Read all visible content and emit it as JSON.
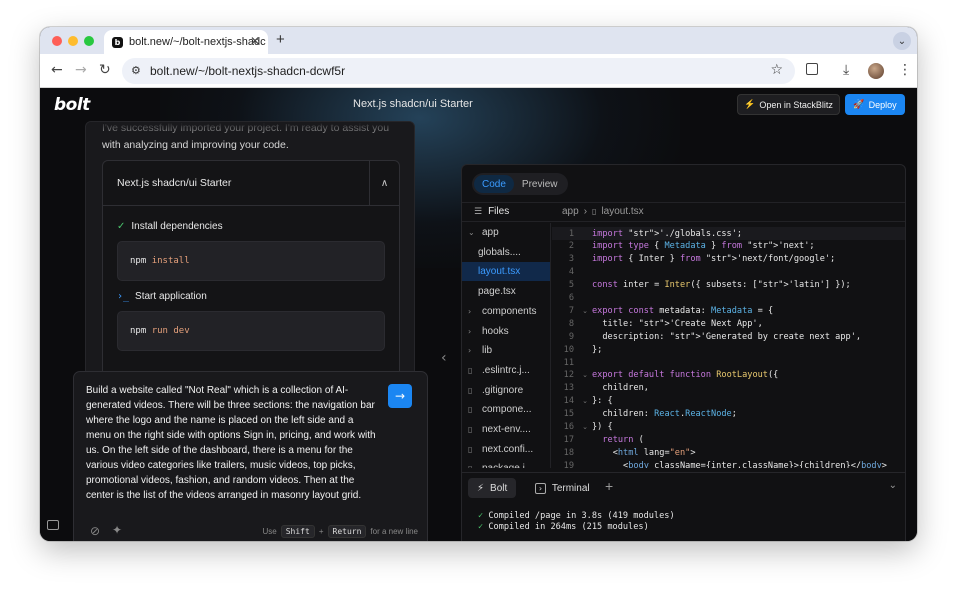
{
  "browser": {
    "tab_title": "bolt.new/~/bolt-nextjs-shadc",
    "favicon_letter": "b",
    "url": "bolt.new/~/bolt-nextjs-shadcn-dcwf5r"
  },
  "app": {
    "logo": "bolt",
    "project_title": "Next.js shadcn/ui Starter",
    "open_in_stackblitz_label": "Open in StackBlitz",
    "deploy_label": "Deploy"
  },
  "chat": {
    "intro_text": "I've successfully imported your project. I'm ready to assist you with analyzing and improving your code.",
    "artifact_title": "Next.js shadcn/ui Starter",
    "steps": [
      {
        "label": "Install dependencies",
        "command_main": "npm",
        "command_args": "install"
      },
      {
        "label": "Start application",
        "command_main": "npm",
        "command_args": "run dev"
      }
    ],
    "prompt_text": "Build a website called \"Not Real\" which is a collection of AI-generated videos. There will be three sections: the navigation bar where the logo and the name is placed on the left side and a menu on the right side with options Sign in, pricing, and work with us. On the left side of the dashboard, there is a menu for the various video categories like trailers, music videos, top picks, promotional videos, fashion, and random videos. Then at the center is the list of the videos arranged in masonry layout grid.",
    "hint_use": "Use",
    "hint_shift": "Shift",
    "hint_plus": "+",
    "hint_return": "Return",
    "hint_suffix": "for a new line"
  },
  "workbench": {
    "tabs": [
      "Code",
      "Preview"
    ],
    "files_label": "Files",
    "breadcrumb": [
      "app",
      "layout.tsx"
    ],
    "tree": [
      {
        "name": "app",
        "type": "folder-open"
      },
      {
        "name": "globals....",
        "type": "file"
      },
      {
        "name": "layout.tsx",
        "type": "file",
        "selected": true
      },
      {
        "name": "page.tsx",
        "type": "file"
      },
      {
        "name": "components",
        "type": "folder"
      },
      {
        "name": "hooks",
        "type": "folder"
      },
      {
        "name": "lib",
        "type": "folder"
      },
      {
        "name": ".eslintrc.j...",
        "type": "file"
      },
      {
        "name": ".gitignore",
        "type": "file"
      },
      {
        "name": "compone...",
        "type": "file"
      },
      {
        "name": "next-env....",
        "type": "file"
      },
      {
        "name": "next.confi...",
        "type": "file"
      },
      {
        "name": "package.j...",
        "type": "file"
      }
    ],
    "code_lines": [
      "import './globals.css';",
      "import type { Metadata } from 'next';",
      "import { Inter } from 'next/font/google';",
      "",
      "const inter = Inter({ subsets: ['latin'] });",
      "",
      "export const metadata: Metadata = {",
      "  title: 'Create Next App',",
      "  description: 'Generated by create next app',",
      "};",
      "",
      "export default function RootLayout({",
      "  children,",
      "}: {",
      "  children: React.ReactNode;",
      "}) {",
      "  return (",
      "    <html lang=\"en\">",
      "      <body className={inter.className}>{children}</body>"
    ],
    "terminal_tabs": [
      "Bolt",
      "Terminal"
    ],
    "terminal_output": [
      "Compiled /page in 3.8s (419 modules)",
      "Compiled in 264ms (215 modules)"
    ]
  }
}
